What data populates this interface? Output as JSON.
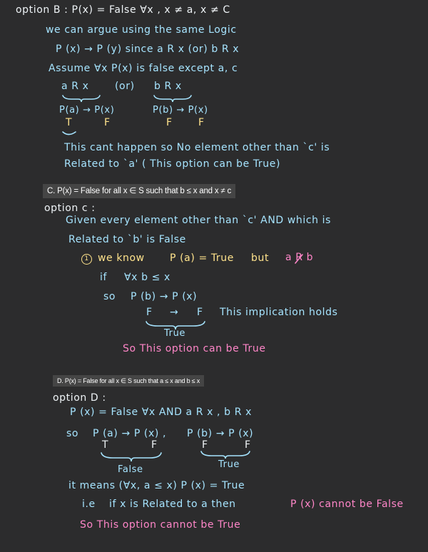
{
  "colors": {
    "background": "#2c2c2d",
    "white": "#eef3f6",
    "blue": "#a6e4ff",
    "yellow": "#ffe38c",
    "pink": "#ff86c8",
    "banner": "#454545"
  },
  "optionB": {
    "heading": "option B :   P(x) = False  ∀x , x ≠ a,  x ≠ C",
    "line1": "we   can   argue   using   the   same  Logic",
    "line2": "P (x)  → P (y)    since    a R x   (or)   b R x",
    "line3": "Assume   ∀x  P(x)  is  false   except  a, c",
    "case_a_head": "a  R  x",
    "or": "(or)",
    "case_b_head": "b  R  x",
    "case_a_impl": "P(a) → P(x)",
    "case_b_impl": "P(b) → P(x)",
    "case_a_T": "T",
    "case_a_F": "F",
    "case_b_F1": "F",
    "case_b_F2": "F",
    "conclusion1": "This  cant  happen   so    No   element  other  than  `c'  is",
    "conclusion2": "Related   to  `a'   ( This  option  can  be  True)"
  },
  "bannerC": "C. P(x) = False for all x ∈ S such that b ≤ x and x ≠ c",
  "optionC": {
    "heading": "option c :",
    "line1": "Given  every  element   other   than  `c'  AND   which  is",
    "line2": "Related  to  `b'  is   False",
    "point_num": "1",
    "we_know": "we   know",
    "pa_true": "P (a)  = True",
    "but": "but",
    "a_not_rb": "a R b",
    "if": "if",
    "forall": "∀x   b ≤ x",
    "so": "so",
    "impl": "P (b)   →  P (x)",
    "F1": "F",
    "arrow": "→",
    "F2": "F",
    "holds": "This  implication  holds",
    "true_label": "True",
    "conclusion": "So  This  option   can   be  True"
  },
  "bannerD": "D. P(x) = False for all x ∈ S such that a ≤ x and b ≤ x",
  "optionD": {
    "heading": "option D :",
    "line1": "P (x) =  False  ∀x   AND   a R x ,   b R x",
    "so": "so",
    "impl1": "P (a)  → P (x) ,",
    "impl2": "P (b)  → P (x)",
    "T": "T",
    "F1": "F",
    "F2": "F",
    "F3": "F",
    "false_label": "False",
    "true_label": "True",
    "line3": "it  means  (∀x,  a ≤ x)  P (x) = True",
    "ie": "i.e",
    "line4": "if   x  is  Related  to   a   then",
    "line4_pink": "P (x)  cannot  be  False",
    "conclusion": "So  This  option   cannot  be  True"
  }
}
